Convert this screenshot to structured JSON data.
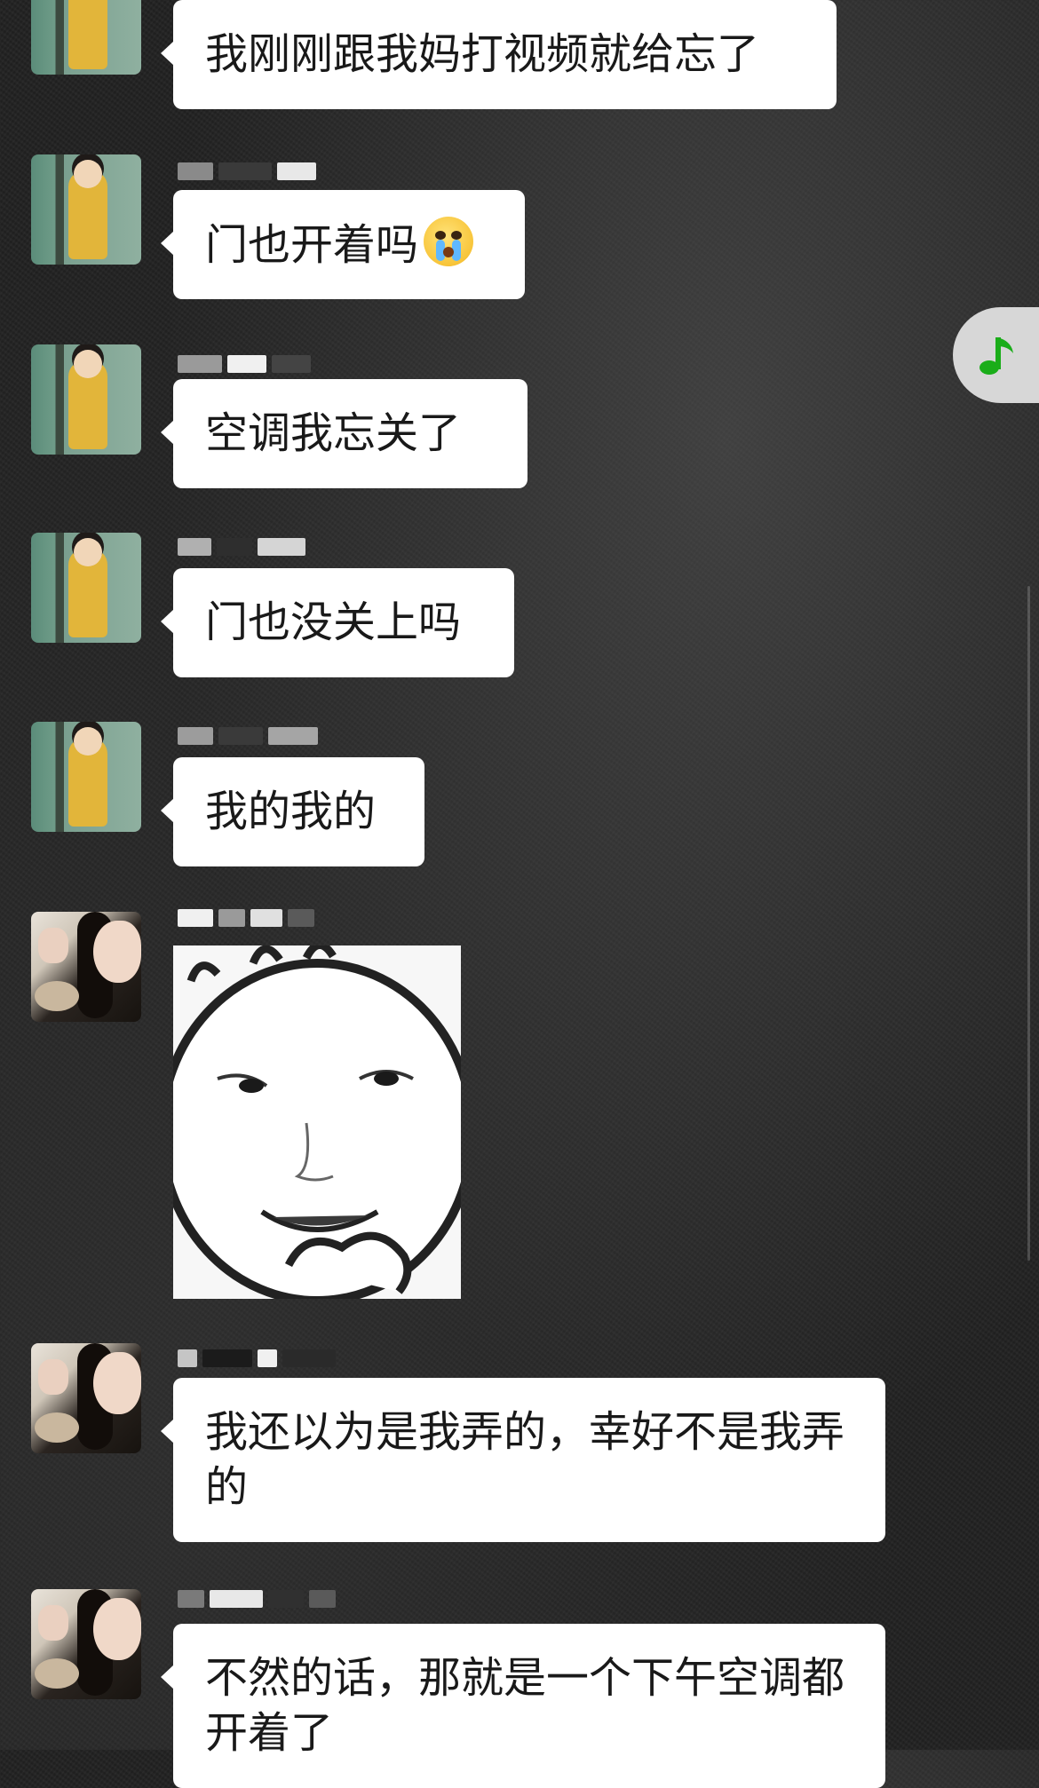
{
  "messages": [
    {
      "text": "我刚刚跟我妈打视频就给忘了"
    },
    {
      "text": "门也开着吗",
      "emoji": "crying-face-emoji"
    },
    {
      "text": "空调我忘关了"
    },
    {
      "text": "门也没关上吗"
    },
    {
      "text": "我的我的"
    },
    {
      "sticker": "smiling-face-sticker"
    },
    {
      "text": "我还以为是我弄的，幸好不是我弄的"
    },
    {
      "text": "不然的话，那就是一个下午空调都开着了"
    }
  ],
  "floating": {
    "music_icon": "music-note-icon",
    "music_color": "#1aad19"
  },
  "colors": {
    "bubble": "#ffffff",
    "text": "#191919",
    "background": "#222222"
  }
}
